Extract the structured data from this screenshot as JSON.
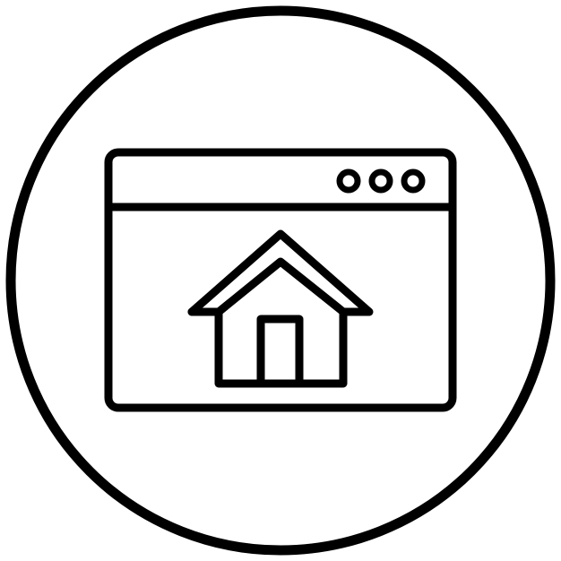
{
  "icon": {
    "name": "home-page-icon",
    "parts": [
      "circle-frame",
      "browser-window",
      "window-dots",
      "house"
    ],
    "dot_count": 3
  },
  "colors": {
    "stroke": "#000000",
    "background": "#ffffff"
  }
}
